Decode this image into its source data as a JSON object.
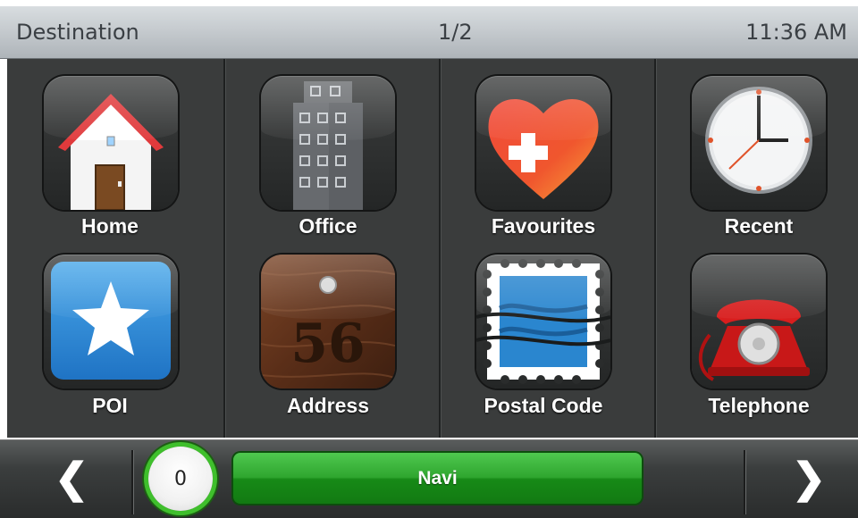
{
  "header": {
    "title": "Destination",
    "page": "1/2",
    "time": "11:36 AM"
  },
  "tiles": [
    {
      "label": "Home"
    },
    {
      "label": "Office"
    },
    {
      "label": "Favourites"
    },
    {
      "label": "Recent"
    },
    {
      "label": "POI"
    },
    {
      "label": "Address",
      "number": "56"
    },
    {
      "label": "Postal Code"
    },
    {
      "label": "Telephone"
    }
  ],
  "footer": {
    "prev": "❮",
    "next": "❯",
    "counter": "0",
    "navi_label": "Navi"
  },
  "colors": {
    "header": "#c6cbcf",
    "grid": "#3a3c3c",
    "navi_green": "#2fa62f",
    "counter_ring": "#3fbf2c"
  },
  "icons": [
    "house-icon",
    "office-building-icon",
    "heart-plus-icon",
    "clock-icon",
    "star-icon",
    "address-plaque-icon",
    "postage-stamp-icon",
    "telephone-icon"
  ]
}
